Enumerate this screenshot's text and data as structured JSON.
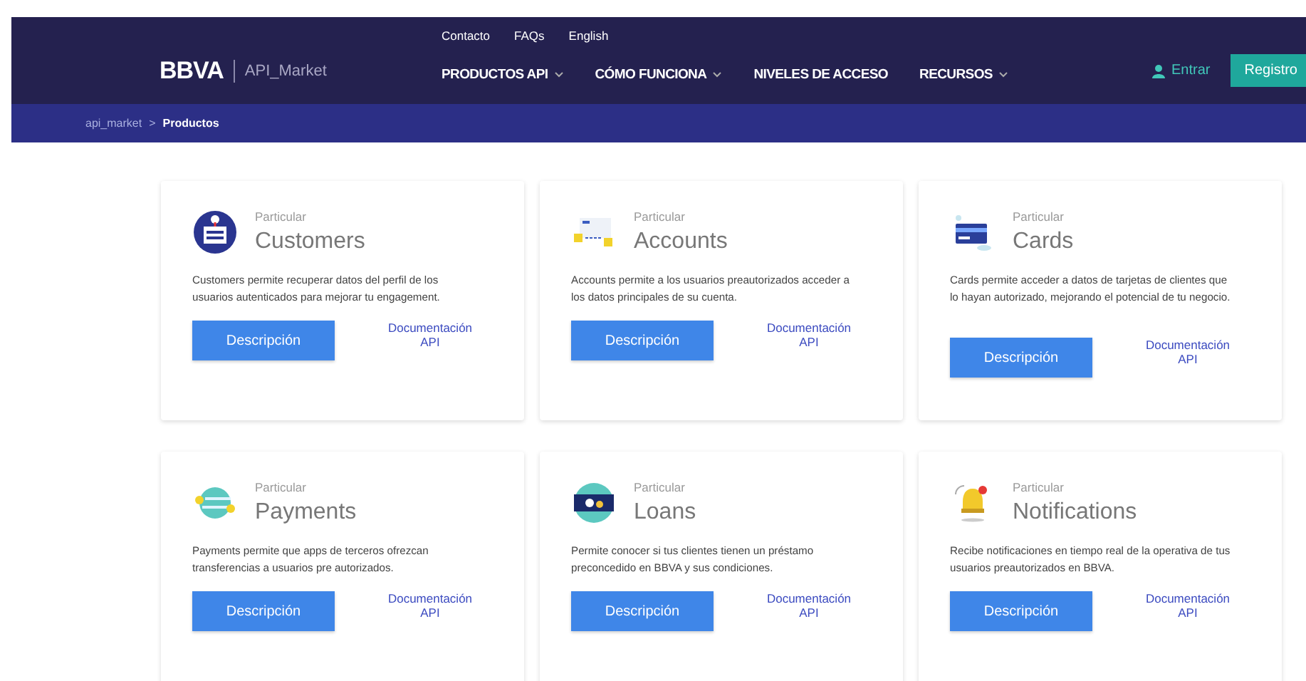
{
  "header": {
    "logo": "BBVA",
    "product": "API_Market",
    "top_links": [
      "Contacto",
      "FAQs",
      "English"
    ],
    "nav": [
      {
        "label": "PRODUCTOS API",
        "dropdown": true
      },
      {
        "label": "CÓMO FUNCIONA",
        "dropdown": true
      },
      {
        "label": "NIVELES DE ACCESO",
        "dropdown": false
      },
      {
        "label": "RECURSOS",
        "dropdown": true
      }
    ],
    "login": "Entrar",
    "register": "Registro"
  },
  "breadcrumb": [
    "api_market",
    ">",
    "Productos"
  ],
  "cards": [
    {
      "kind": "customers",
      "category": "Particular",
      "title": "Customers",
      "description": "Customers permite recuperar datos del perfil de los usuarios autenticados para mejorar tu engagement.",
      "button": "Descripción",
      "link": "Documentación API"
    },
    {
      "kind": "accounts",
      "category": "Particular",
      "title": "Accounts",
      "description": "Accounts permite a los usuarios preautorizados acceder a los datos principales de su cuenta.",
      "button": "Descripción",
      "link": "Documentación API"
    },
    {
      "kind": "cards",
      "category": "Particular",
      "title": "Cards",
      "description": "Cards permite acceder a datos de tarjetas de clientes que lo hayan autorizado, mejorando el potencial de tu negocio.",
      "button": "Descripción",
      "link": "Documentación API"
    },
    {
      "kind": "payments",
      "category": "Particular",
      "title": "Payments",
      "description": "Payments permite que apps de terceros ofrezcan transferencias a usuarios pre autorizados.",
      "button": "Descripción",
      "link": "Documentación API"
    },
    {
      "kind": "loans",
      "category": "Particular",
      "title": "Loans",
      "description": "Permite conocer si tus clientes tienen un préstamo preconcedido en BBVA y sus condiciones.",
      "button": "Descripción",
      "link": "Documentación API"
    },
    {
      "kind": "notifications",
      "category": "Particular",
      "title": "Notifications",
      "description": "Recibe notificaciones en tiempo real de la operativa de tus usuarios preautorizados en BBVA.",
      "button": "Descripción",
      "link": "Documentación API"
    }
  ]
}
